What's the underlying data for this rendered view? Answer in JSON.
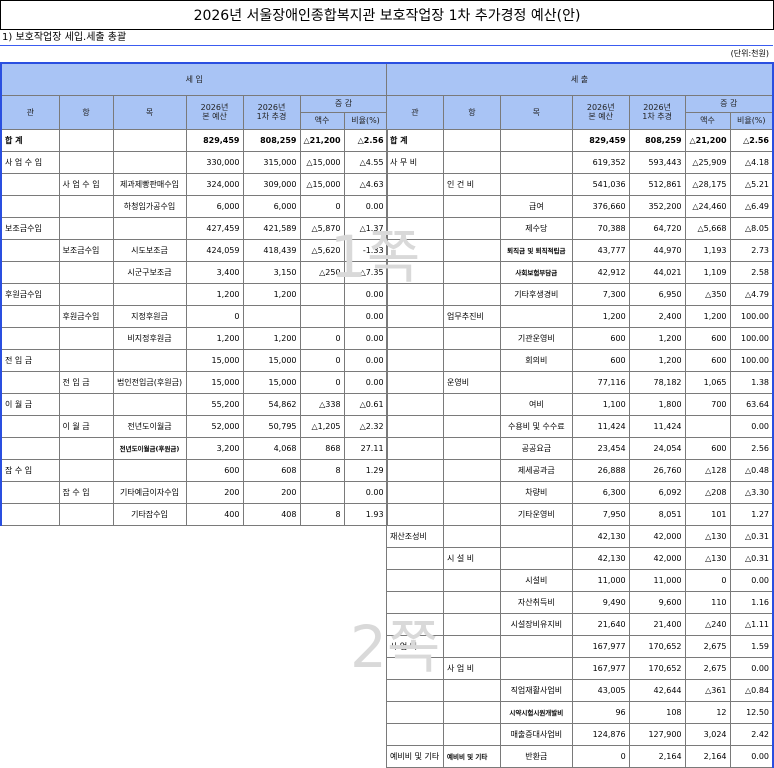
{
  "title": "2026년 서울장애인종합복지관 보호작업장 1차 추가경정 예산(안)",
  "subtitle": "1) 보호작업장 세입.세출 총괄",
  "unit": "(단위:천원)",
  "watermarks": {
    "page1": "1쪽",
    "page2": "2쪽"
  },
  "left": {
    "section": "세        입",
    "headers": {
      "gwan": "관",
      "hang": "항",
      "mok": "목",
      "orig": "2026년\n본 예산",
      "revised": "2026년\n1차 추경",
      "change": "증     감",
      "amount": "액수",
      "ratio": "비율(%)"
    },
    "rows": [
      [
        "합        계",
        "",
        "",
        "829,459",
        "808,259",
        "△21,200",
        "△2.56"
      ],
      [
        "사 업 수 입",
        "",
        "",
        "330,000",
        "315,000",
        "△15,000",
        "△4.55"
      ],
      [
        "",
        "사 업 수 입",
        "제과제빵판매수입",
        "324,000",
        "309,000",
        "△15,000",
        "△4.63"
      ],
      [
        "",
        "",
        "하청임가공수입",
        "6,000",
        "6,000",
        "0",
        "0.00"
      ],
      [
        "보조금수입",
        "",
        "",
        "427,459",
        "421,589",
        "△5,870",
        "△1.37"
      ],
      [
        "",
        "보조금수입",
        "시도보조금",
        "424,059",
        "418,439",
        "△5,620",
        "-1.33"
      ],
      [
        "",
        "",
        "시군구보조금",
        "3,400",
        "3,150",
        "△250",
        "△7.35"
      ],
      [
        "후원금수입",
        "",
        "",
        "1,200",
        "1,200",
        "",
        "0.00"
      ],
      [
        "",
        "후원금수입",
        "지정후원금",
        "0",
        "",
        "",
        "0.00"
      ],
      [
        "",
        "",
        "비지정후원금",
        "1,200",
        "1,200",
        "0",
        "0.00"
      ],
      [
        "전  입  금",
        "",
        "",
        "15,000",
        "15,000",
        "0",
        "0.00"
      ],
      [
        "",
        "전  입  금",
        "법인전입금(후원금)",
        "15,000",
        "15,000",
        "0",
        "0.00"
      ],
      [
        "이  월  금",
        "",
        "",
        "55,200",
        "54,862",
        "△338",
        "△0.61"
      ],
      [
        "",
        "이  월  금",
        "전년도이월금",
        "52,000",
        "50,795",
        "△1,205",
        "△2.32"
      ],
      [
        "",
        "",
        "전년도이월금(후원금)",
        "3,200",
        "4,068",
        "868",
        "27.11"
      ],
      [
        "잡  수  입",
        "",
        "",
        "600",
        "608",
        "8",
        "1.29"
      ],
      [
        "",
        "잡  수  입",
        "기타예금이자수입",
        "200",
        "200",
        "",
        "0.00"
      ],
      [
        "",
        "",
        "기타잡수입",
        "400",
        "408",
        "8",
        "1.93"
      ]
    ]
  },
  "right": {
    "section": "세        출",
    "headers": {
      "gwan": "관",
      "hang": "항",
      "mok": "목",
      "orig": "2026년\n본 예산",
      "revised": "2026년\n1차 추경",
      "change": "증     감",
      "amount": "액수",
      "ratio": "비율(%)"
    },
    "rows": [
      [
        "합        계",
        "",
        "",
        "829,459",
        "808,259",
        "△21,200",
        "△2.56"
      ],
      [
        "사  무  비",
        "",
        "",
        "619,352",
        "593,443",
        "△25,909",
        "△4.18"
      ],
      [
        "",
        "인  건  비",
        "",
        "541,036",
        "512,861",
        "△28,175",
        "△5.21"
      ],
      [
        "",
        "",
        "급여",
        "376,660",
        "352,200",
        "△24,460",
        "△6.49"
      ],
      [
        "",
        "",
        "제수당",
        "70,388",
        "64,720",
        "△5,668",
        "△8.05"
      ],
      [
        "",
        "",
        "퇴직금 및 퇴직적립금",
        "43,777",
        "44,970",
        "1,193",
        "2.73"
      ],
      [
        "",
        "",
        "사회보험부담금",
        "42,912",
        "44,021",
        "1,109",
        "2.58"
      ],
      [
        "",
        "",
        "기타후생경비",
        "7,300",
        "6,950",
        "△350",
        "△4.79"
      ],
      [
        "",
        "업무추진비",
        "",
        "1,200",
        "2,400",
        "1,200",
        "100.00"
      ],
      [
        "",
        "",
        "기관운영비",
        "600",
        "1,200",
        "600",
        "100.00"
      ],
      [
        "",
        "",
        "회의비",
        "600",
        "1,200",
        "600",
        "100.00"
      ],
      [
        "",
        "운영비",
        "",
        "77,116",
        "78,182",
        "1,065",
        "1.38"
      ],
      [
        "",
        "",
        "여비",
        "1,100",
        "1,800",
        "700",
        "63.64"
      ],
      [
        "",
        "",
        "수용비 및 수수료",
        "11,424",
        "11,424",
        "",
        "0.00"
      ],
      [
        "",
        "",
        "공공요금",
        "23,454",
        "24,054",
        "600",
        "2.56"
      ],
      [
        "",
        "",
        "제세공과금",
        "26,888",
        "26,760",
        "△128",
        "△0.48"
      ],
      [
        "",
        "",
        "차량비",
        "6,300",
        "6,092",
        "△208",
        "△3.30"
      ],
      [
        "",
        "",
        "기타운영비",
        "7,950",
        "8,051",
        "101",
        "1.27"
      ],
      [
        "재산조성비",
        "",
        "",
        "42,130",
        "42,000",
        "△130",
        "△0.31"
      ],
      [
        "",
        "시  설  비",
        "",
        "42,130",
        "42,000",
        "△130",
        "△0.31"
      ],
      [
        "",
        "",
        "시설비",
        "11,000",
        "11,000",
        "0",
        "0.00"
      ],
      [
        "",
        "",
        "자산취득비",
        "9,490",
        "9,600",
        "110",
        "1.16"
      ],
      [
        "",
        "",
        "시설장비유지비",
        "21,640",
        "21,400",
        "△240",
        "△1.11"
      ],
      [
        "사  업  비",
        "",
        "",
        "167,977",
        "170,652",
        "2,675",
        "1.59"
      ],
      [
        "",
        "사  업  비",
        "",
        "167,977",
        "170,652",
        "2,675",
        "0.00"
      ],
      [
        "",
        "",
        "직업재활사업비",
        "43,005",
        "42,644",
        "△361",
        "△0.84"
      ],
      [
        "",
        "",
        "시약시험시원개발비",
        "96",
        "108",
        "12",
        "12.50"
      ],
      [
        "",
        "",
        "매출증대사업비",
        "124,876",
        "127,900",
        "3,024",
        "2.42"
      ],
      [
        "예비비 및 기타",
        "예비비 및 기타",
        "반환금",
        "0",
        "2,164",
        "2,164",
        "0.00"
      ]
    ]
  }
}
